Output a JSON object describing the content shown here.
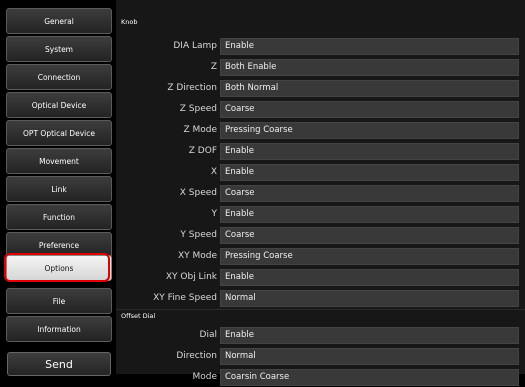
{
  "sidebar": {
    "items": [
      {
        "label": "General"
      },
      {
        "label": "System"
      },
      {
        "label": "Connection"
      },
      {
        "label": "Optical Device"
      },
      {
        "label": "OPT Optical Device"
      },
      {
        "label": "Movement"
      },
      {
        "label": "Link"
      },
      {
        "label": "Function"
      },
      {
        "label": "Preference"
      },
      {
        "label": "Options"
      },
      {
        "label": "File"
      },
      {
        "label": "Information"
      }
    ],
    "active_index": 9,
    "send_label": "Send"
  },
  "knob": {
    "title": "Knob",
    "rows": [
      {
        "label": "DIA Lamp",
        "value": "Enable"
      },
      {
        "label": "Z",
        "value": "Both Enable"
      },
      {
        "label": "Z Direction",
        "value": "Both Normal"
      },
      {
        "label": "Z Speed",
        "value": "Coarse"
      },
      {
        "label": "Z Mode",
        "value": "Pressing Coarse"
      },
      {
        "label": "Z DOF",
        "value": "Enable"
      },
      {
        "label": "X",
        "value": "Enable"
      },
      {
        "label": "X Speed",
        "value": "Coarse"
      },
      {
        "label": "Y",
        "value": "Enable"
      },
      {
        "label": "Y Speed",
        "value": "Coarse"
      },
      {
        "label": "XY Mode",
        "value": "Pressing Coarse"
      },
      {
        "label": "XY Obj Link",
        "value": "Enable"
      },
      {
        "label": "XY Fine Speed",
        "value": "Normal"
      }
    ]
  },
  "offset_dial": {
    "title": "Offset Dial",
    "rows": [
      {
        "label": "Dial",
        "value": "Enable"
      },
      {
        "label": "Direction",
        "value": "Normal"
      },
      {
        "label": "Mode",
        "value": "Coarsin Coarse"
      }
    ]
  }
}
